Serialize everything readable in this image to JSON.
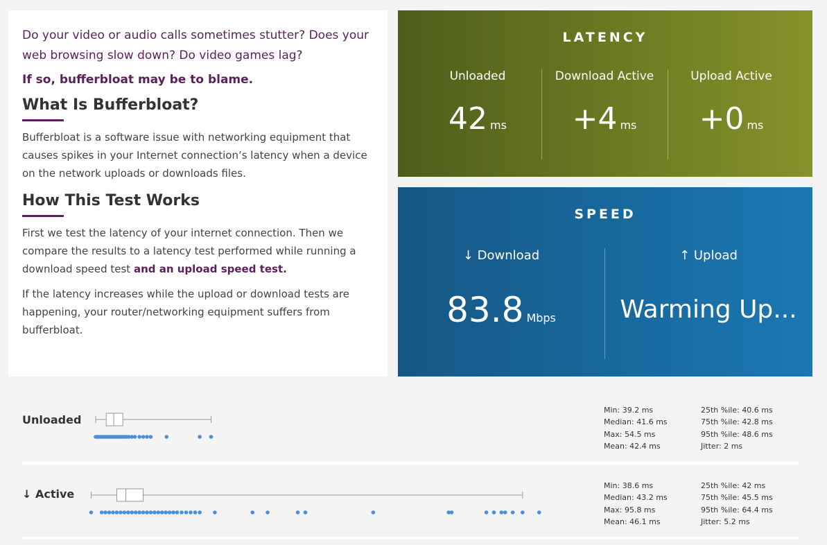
{
  "info": {
    "intro": "Do your video or audio calls sometimes stutter? Does your web browsing slow down? Do video games lag?",
    "blame": "If so, bufferbloat may be to blame.",
    "what_title": "What Is Bufferbloat?",
    "what_text": "Bufferbloat is a software issue with networking equipment that causes spikes in your Internet connection’s latency when a device on the network uploads or downloads files.",
    "how_title": "How This Test Works",
    "how_text_1a": "First we test the latency of your internet connection. Then we compare the results to a latency test performed while running a download speed test ",
    "how_text_1b": "and an upload speed test.",
    "how_text_2": "If the latency increases while the upload or download tests are happening, your router/networking equipment suffers from bufferbloat."
  },
  "latency": {
    "title": "LATENCY",
    "cols": [
      {
        "label": "Unloaded",
        "value": "42",
        "unit": "ms"
      },
      {
        "label": "Download Active",
        "value": "+4",
        "unit": "ms"
      },
      {
        "label": "Upload Active",
        "value": "+0",
        "unit": "ms"
      }
    ]
  },
  "speed": {
    "title": "SPEED",
    "download": {
      "label": "↓ Download",
      "value": "83.8",
      "unit": "Mbps"
    },
    "upload": {
      "label": "↑ Upload",
      "value": "Warming Up..."
    }
  },
  "colors": {
    "accent": "#5c1f5e",
    "dot": "#4a90d9",
    "latency_bg": "#6b7b22",
    "speed_bg": "#1866a0"
  },
  "rows": [
    {
      "label": "Unloaded",
      "box": {
        "min": 39.2,
        "q1": 40.6,
        "median": 41.6,
        "q3": 42.8,
        "max": 54.5
      },
      "dots": [
        39.2,
        39.4,
        39.6,
        39.8,
        40.0,
        40.2,
        40.4,
        40.6,
        40.8,
        41.0,
        41.2,
        41.4,
        41.6,
        41.8,
        42.0,
        42.2,
        42.4,
        42.6,
        42.8,
        43.0,
        43.3,
        43.6,
        44.0,
        44.4,
        45.0,
        45.5,
        46.0,
        46.5,
        48.6,
        53.0,
        54.5
      ],
      "stats_left": [
        "Min: 39.2 ms",
        "Median: 41.6 ms",
        "Max: 54.5 ms",
        "Mean: 42.4 ms"
      ],
      "stats_right": [
        "25th %ile: 40.6 ms",
        "75th %ile: 42.8 ms",
        "95th %ile: 48.6 ms",
        "Jitter: 2 ms"
      ]
    },
    {
      "label": "↓ Active",
      "box": {
        "min": 38.6,
        "q1": 42,
        "median": 43.2,
        "q3": 45.5,
        "max": 95.8
      },
      "dots": [
        38.6,
        40.0,
        40.5,
        41.0,
        41.5,
        42.0,
        42.5,
        43.0,
        43.5,
        44.0,
        44.5,
        45.0,
        45.5,
        46.0,
        46.5,
        47.0,
        47.5,
        48.0,
        48.5,
        49.0,
        49.5,
        50.0,
        50.6,
        51.2,
        51.8,
        52.4,
        53.0,
        55.0,
        60.0,
        62.0,
        66.0,
        67.0,
        76.0,
        86.0,
        86.4,
        91.0,
        92.0,
        93.0,
        93.5,
        94.5,
        95.8,
        98.0
      ],
      "stats_left": [
        "Min: 38.6 ms",
        "Median: 43.2 ms",
        "Max: 95.8 ms",
        "Mean: 46.1 ms"
      ],
      "stats_right": [
        "25th %ile: 42 ms",
        "75th %ile: 45.5 ms",
        "95th %ile: 64.4 ms",
        "Jitter: 5.2 ms"
      ]
    }
  ]
}
